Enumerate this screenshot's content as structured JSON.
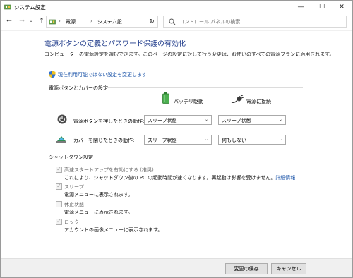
{
  "window": {
    "title": "システム設定"
  },
  "controls": {
    "minimize": "—",
    "maximize": "☐",
    "close": "✕"
  },
  "nav": {
    "back": "←",
    "forward": "→",
    "recent": "⌄",
    "up": "↑",
    "breadcrumb": [
      "電源...",
      "システム設..."
    ],
    "separator": "›",
    "dropdown": "⌄",
    "refresh": "↻",
    "search_placeholder": "コントロール パネルの検索"
  },
  "page": {
    "title": "電源ボタンの定義とパスワード保護の有効化",
    "description": "コンピューターの電源設定を選択できます。このページの設定に対して行う変更は、お使いのすべての電源プランに適用されます。",
    "admin_link": "現在利用可能ではない設定を変更します"
  },
  "power_section": {
    "heading": "電源ボタンとカバーの設定",
    "col_battery": "バッテリ駆動",
    "col_plugged": "電源に接続",
    "rows": [
      {
        "label": "電源ボタンを押したときの動作:",
        "battery": "スリープ状態",
        "plugged": "スリープ状態"
      },
      {
        "label": "カバーを閉じたときの動作:",
        "battery": "スリープ状態",
        "plugged": "何もしない"
      }
    ]
  },
  "shutdown_section": {
    "heading": "シャットダウン設定",
    "items": [
      {
        "label": "高速スタートアップを有効にする (推奨)",
        "desc": "これにより、シャットダウン後の PC の起動時間が速くなります。再起動は影響を受けません。",
        "link": "詳細情報",
        "checked": true
      },
      {
        "label": "スリープ",
        "desc": "電源メニューに表示されます。",
        "checked": true
      },
      {
        "label": "休止状態",
        "desc": "電源メニューに表示されます。",
        "checked": false
      },
      {
        "label": "ロック",
        "desc": "アカウントの画像メニューに表示されます。",
        "checked": true
      }
    ]
  },
  "footer": {
    "save": "変更の保存",
    "cancel": "キャンセル"
  },
  "colors": {
    "title_blue": "#1e3a8a",
    "link_blue": "#1a53a8",
    "battery_green": "#4caf50"
  }
}
